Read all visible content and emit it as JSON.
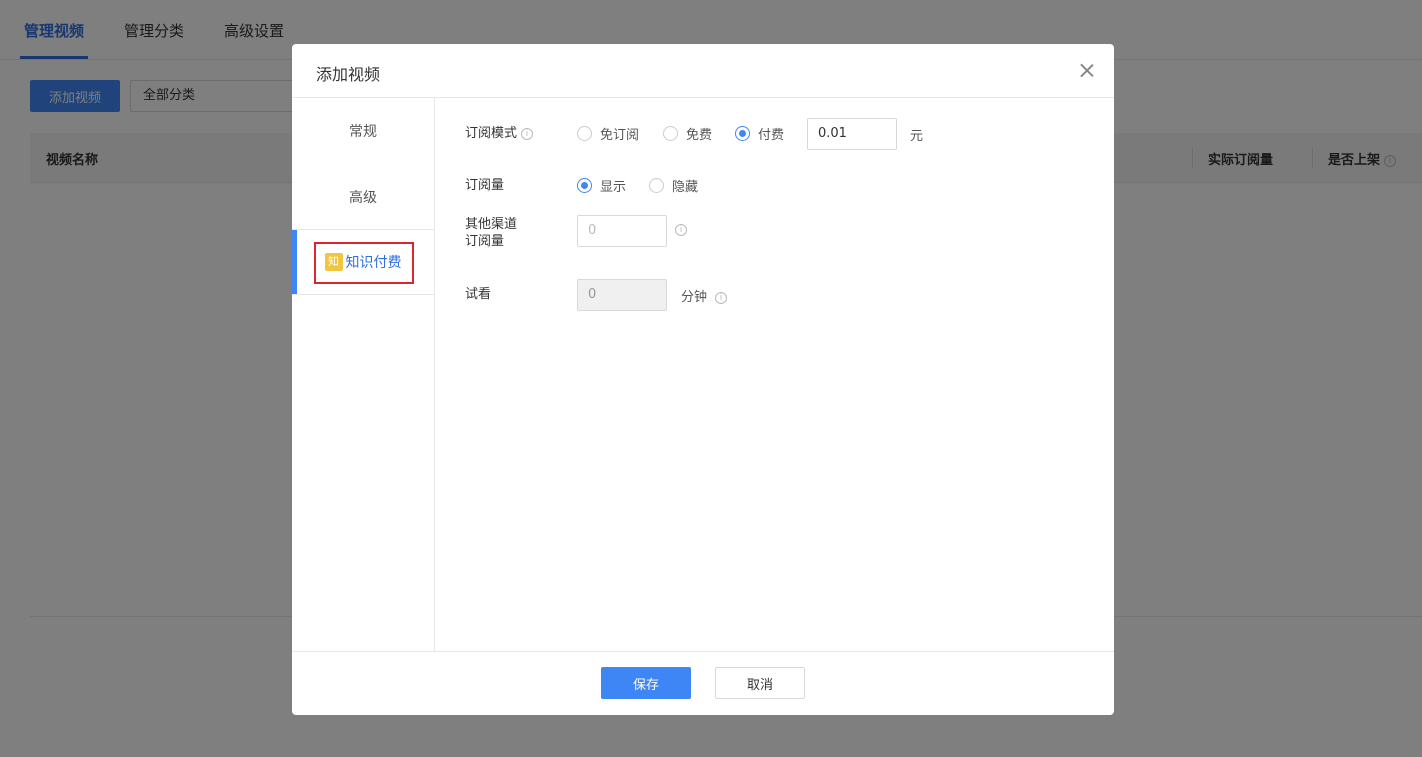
{
  "background": {
    "tabs": [
      "管理视频",
      "管理分类",
      "高级设置"
    ],
    "add_video_label": "添加视频",
    "category_select_value": "全部分类",
    "table_columns": [
      "视频名称",
      "实际订阅量",
      "是否上架"
    ]
  },
  "modal": {
    "title": "添加视频",
    "side_nav": [
      "常规",
      "高级",
      "知识付费"
    ],
    "badge_text": "知",
    "form": {
      "subscription_mode_label": "订阅模式",
      "subscription_mode_options": [
        "免订阅",
        "免费",
        "付费"
      ],
      "subscription_mode_selected": "付费",
      "price_value": "0.01",
      "price_unit": "元",
      "subscription_count_label": "订阅量",
      "subscription_count_options": [
        "显示",
        "隐藏"
      ],
      "subscription_count_selected": "显示",
      "other_channel_label_line1": "其他渠道",
      "other_channel_label_line2": "订阅量",
      "other_channel_placeholder": "0",
      "trial_label": "试看",
      "trial_value": "0",
      "trial_unit": "分钟"
    },
    "save_label": "保存",
    "cancel_label": "取消"
  },
  "colors": {
    "accent": "#3e86f5",
    "highlight_box": "#d8272f",
    "badge": "#f0c542"
  }
}
